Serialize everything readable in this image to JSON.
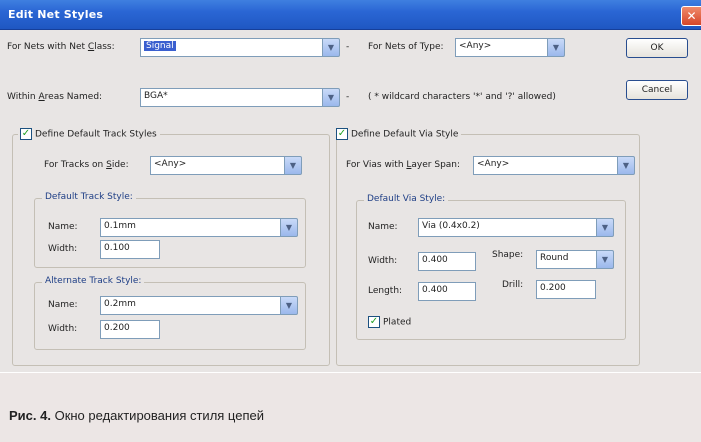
{
  "window": {
    "title": "Edit Net Styles",
    "close_glyph": "✕"
  },
  "filters": {
    "net_class_label_pre": "For Nets with Net ",
    "net_class_label_u": "C",
    "net_class_label_post": "lass:",
    "net_class_value": "Signal",
    "dash1": "-",
    "net_type_label": "For Nets of Type:",
    "net_type_value": "<Any>",
    "areas_label_pre": "Within ",
    "areas_label_u": "A",
    "areas_label_post": "reas Named:",
    "areas_value": "BGA*",
    "dash2": "-",
    "wildcard_hint": "( * wildcard characters '*' and '?' allowed)"
  },
  "buttons": {
    "ok": "OK",
    "cancel": "Cancel"
  },
  "track": {
    "define_label": "Define Default Track Styles",
    "define_checked": true,
    "side_label_pre": "For Tracks on ",
    "side_label_u": "S",
    "side_label_post": "ide:",
    "side_value": "<Any>",
    "default_group": "Default Track Style:",
    "default_name_label": "Name:",
    "default_name_value": "0.1mm",
    "default_width_label": "Width:",
    "default_width_value": "0.100",
    "alternate_group": "Alternate Track Style:",
    "alt_name_label": "Name:",
    "alt_name_value": "0.2mm",
    "alt_width_label": "Width:",
    "alt_width_value": "0.200"
  },
  "via": {
    "define_label": "Define Default Via Style",
    "define_checked": true,
    "span_label_pre": "For Vias with ",
    "span_label_u": "L",
    "span_label_post": "ayer Span:",
    "span_value": "<Any>",
    "group": "Default Via Style:",
    "name_label": "Name:",
    "name_value": "Via (0.4x0.2)",
    "width_label": "Width:",
    "width_value": "0.400",
    "shape_label": "Shape:",
    "shape_value": "Round",
    "length_label": "Length:",
    "length_value": "0.400",
    "drill_label": "Drill:",
    "drill_value": "0.200",
    "plated_label": "Plated",
    "plated_checked": true
  },
  "caption": {
    "prefix": "Рис. 4.",
    "text": " Окно редактирования стиля цепей"
  }
}
